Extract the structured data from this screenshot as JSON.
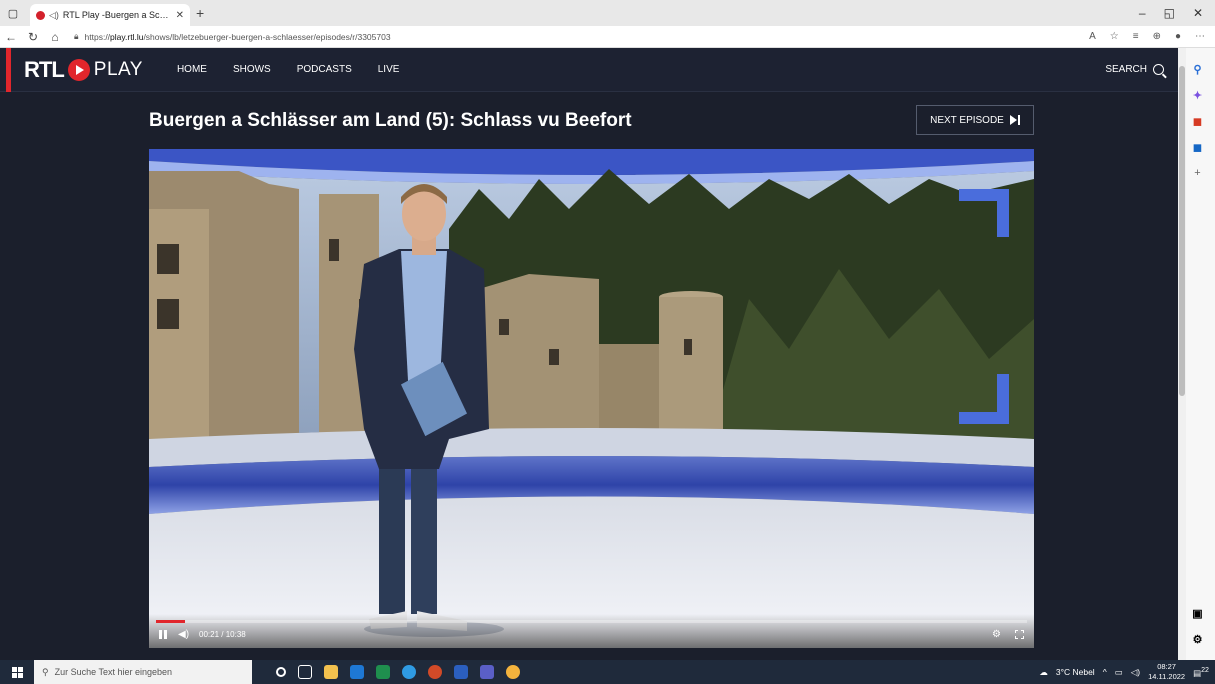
{
  "browser": {
    "tab_title": "RTL Play -Buergen a Schläss",
    "url_prefix": "https://",
    "url_host": "play.rtl.lu",
    "url_path": "/shows/lb/letzebuerger-buergen-a-schlaesser/episodes/r/3305703"
  },
  "site": {
    "logo_rtl": "RTL",
    "logo_play": "PLAY",
    "nav": [
      "HOME",
      "SHOWS",
      "PODCASTS",
      "LIVE"
    ],
    "search_label": "SEARCH"
  },
  "episode": {
    "title": "Buergen a Schlässer am Land (5): Schlass vu Beefort",
    "next_label": "NEXT EPISODE"
  },
  "player": {
    "time": "00:21 / 10:38",
    "progress": 0.033,
    "state": "playing"
  },
  "taskbar": {
    "search_placeholder": "Zur Suche Text hier eingeben",
    "weather": "3°C Nebel",
    "time": "08:27",
    "date": "14.11.2022",
    "notifications": "22"
  },
  "colors": {
    "accent": "#e1262c",
    "page_bg": "#1b1f2c"
  }
}
